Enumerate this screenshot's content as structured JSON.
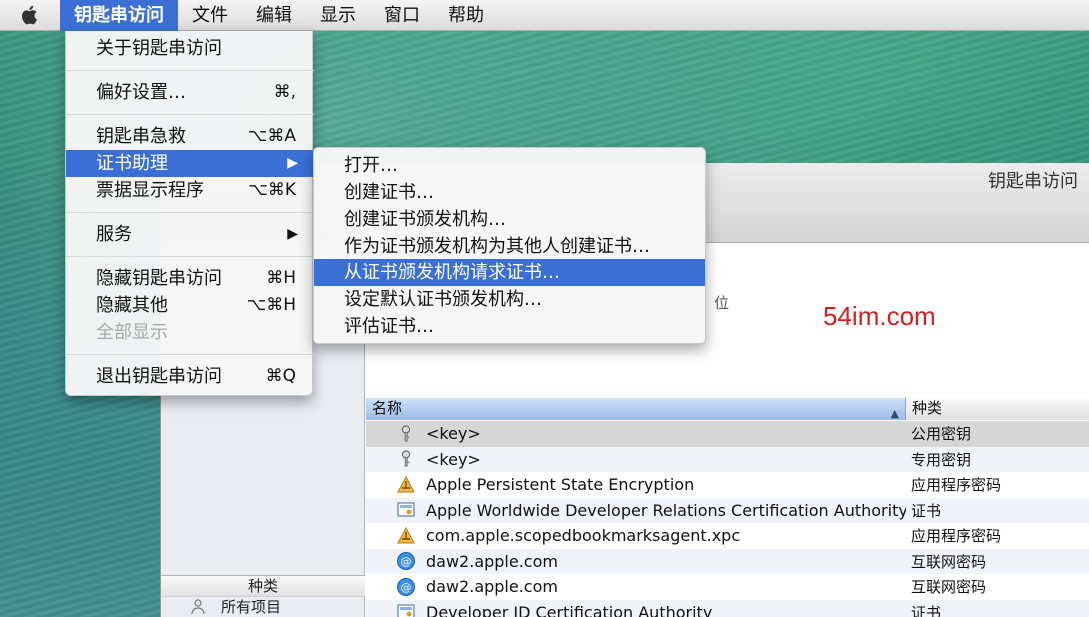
{
  "menubar": {
    "items": [
      "钥匙串访问",
      "文件",
      "编辑",
      "显示",
      "窗口",
      "帮助"
    ]
  },
  "app_menu": {
    "items": [
      {
        "label": "关于钥匙串访问",
        "shortcut": ""
      },
      {
        "label": "偏好设置…",
        "shortcut": "⌘,"
      },
      {
        "label": "钥匙串急救",
        "shortcut": "⌥⌘A"
      },
      {
        "label": "证书助理",
        "shortcut": "▶"
      },
      {
        "label": "票据显示程序",
        "shortcut": "⌥⌘K"
      },
      {
        "label": "服务",
        "shortcut": "▶"
      },
      {
        "label": "隐藏钥匙串访问",
        "shortcut": "⌘H"
      },
      {
        "label": "隐藏其他",
        "shortcut": "⌥⌘H"
      },
      {
        "label": "全部显示",
        "shortcut": ""
      },
      {
        "label": "退出钥匙串访问",
        "shortcut": "⌘Q"
      }
    ]
  },
  "submenu": {
    "items": [
      "打开…",
      "创建证书…",
      "创建证书颁发机构…",
      "作为证书颁发机构为其他人创建证书…",
      "从证书颁发机构请求证书…",
      "设定默认证书颁发机构…",
      "评估证书…"
    ]
  },
  "window": {
    "title": "钥匙串访问",
    "info_partial_text": "位",
    "watermark": "54im.com"
  },
  "sidebar": {
    "footer_header": "种类",
    "footer_item": "所有项目"
  },
  "table": {
    "columns": [
      "名称",
      "种类"
    ],
    "sort_indicator": "▲",
    "rows": [
      {
        "name": "<key>",
        "kind": "公用密钥",
        "icon": "key-icon"
      },
      {
        "name": "<key>",
        "kind": "专用密钥",
        "icon": "key-icon"
      },
      {
        "name": "Apple Persistent State Encryption",
        "kind": "应用程序密码",
        "icon": "app-password-icon"
      },
      {
        "name": "Apple Worldwide Developer Relations Certification Authority",
        "kind": "证书",
        "icon": "certificate-icon"
      },
      {
        "name": "com.apple.scopedbookmarksagent.xpc",
        "kind": "应用程序密码",
        "icon": "app-password-icon"
      },
      {
        "name": "daw2.apple.com",
        "kind": "互联网密码",
        "icon": "internet-password-icon"
      },
      {
        "name": "daw2.apple.com",
        "kind": "互联网密码",
        "icon": "internet-password-icon"
      },
      {
        "name": "Developer ID Certification Authority",
        "kind": "证书",
        "icon": "certificate-icon"
      }
    ]
  },
  "colors": {
    "highlight": "#3b6fd6",
    "watermark": "#d81e1e"
  }
}
